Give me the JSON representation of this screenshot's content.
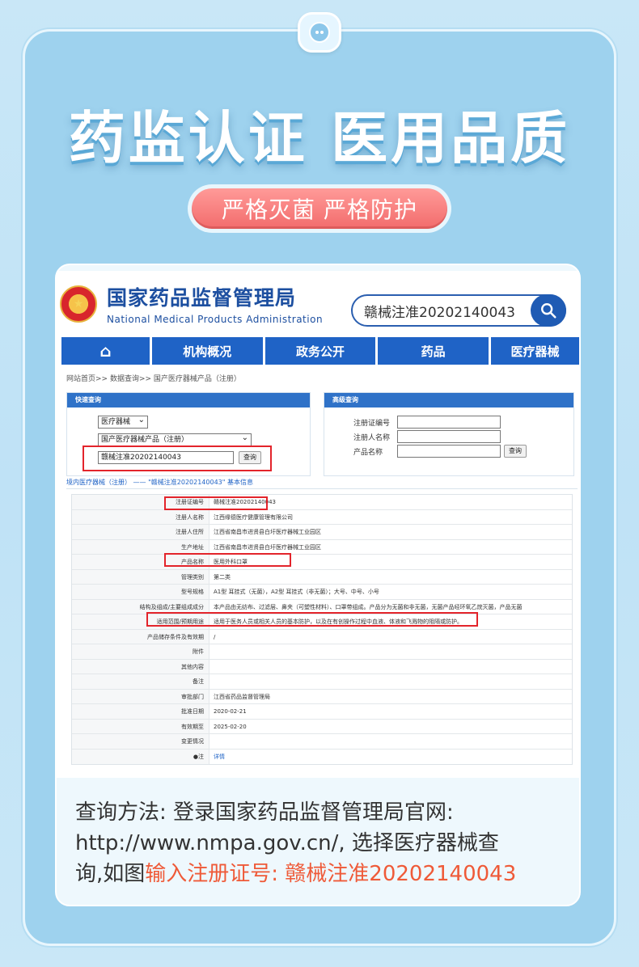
{
  "header": {
    "title": "药监认证 医用品质",
    "pill": "严格灭菌 严格防护"
  },
  "site": {
    "org_cn": "国家药品监督管理局",
    "org_en": "National Medical Products Administration",
    "emblem_glyph": "★",
    "search_value": "赣械注准20202140043",
    "nav": [
      "⌂",
      "机构概况",
      "政务公开",
      "药品",
      "医疗器械"
    ],
    "breadcrumb": "网站首页>> 数据查询>> 国产医疗器械产品（注册）"
  },
  "quick_query": {
    "title": "快速查询",
    "select1": "医疗器械",
    "select2": "国产医疗器械产品（注册）",
    "input_value": "赣械注准20202140043",
    "button": "查询"
  },
  "advanced_query": {
    "title": "高级查询",
    "labels": [
      "注册证编号",
      "注册人名称",
      "产品名称"
    ],
    "button": "查询"
  },
  "detail": {
    "heading": "境内医疗器械（注册） —— \"赣械注准20202140043\" 基本信息",
    "rows": [
      {
        "k": "注册证编号",
        "v": "赣械注准20202140043"
      },
      {
        "k": "注册人名称",
        "v": "江西缘德医疗健康管理有限公司"
      },
      {
        "k": "注册人住所",
        "v": "江西省南昌市进贤县白圩医疗器械工业园区"
      },
      {
        "k": "生产地址",
        "v": "江西省南昌市进贤县白圩医疗器械工业园区"
      },
      {
        "k": "产品名称",
        "v": "医用外科口罩"
      },
      {
        "k": "管理类别",
        "v": "第二类"
      },
      {
        "k": "型号规格",
        "v": "A1型 耳挂式（无菌），A2型 耳挂式（非无菌）；大号、中号、小号"
      },
      {
        "k": "结构及组成/主要组成成分",
        "v": "本产品由无纺布、过滤层、鼻夹（可塑性材料）、口罩带组成。产品分为无菌和非无菌，无菌产品经环氧乙烷灭菌，产品无菌"
      },
      {
        "k": "适用范围/预期用途",
        "v": "适用于医务人员或相关人员的基本防护，以及在有创操作过程中血液、体液和飞溅物的阻隔或防护。"
      },
      {
        "k": "产品储存条件及有效期",
        "v": "/"
      },
      {
        "k": "附件",
        "v": ""
      },
      {
        "k": "其他内容",
        "v": ""
      },
      {
        "k": "备注",
        "v": ""
      },
      {
        "k": "审批部门",
        "v": "江西省药品监督管理局"
      },
      {
        "k": "批准日期",
        "v": "2020-02-21"
      },
      {
        "k": "有效期至",
        "v": "2025-02-20"
      },
      {
        "k": "变更情况",
        "v": ""
      },
      {
        "k": "●注",
        "v": "详情"
      }
    ]
  },
  "footer": {
    "line1": "查询方法: 登录国家药品监督管理局官网:",
    "line2": "http://www.nmpa.gov.cn/, 选择医疗器械查",
    "line3a": "询,如图",
    "line3b": "输入注册证号: 赣械注准20202140043"
  }
}
